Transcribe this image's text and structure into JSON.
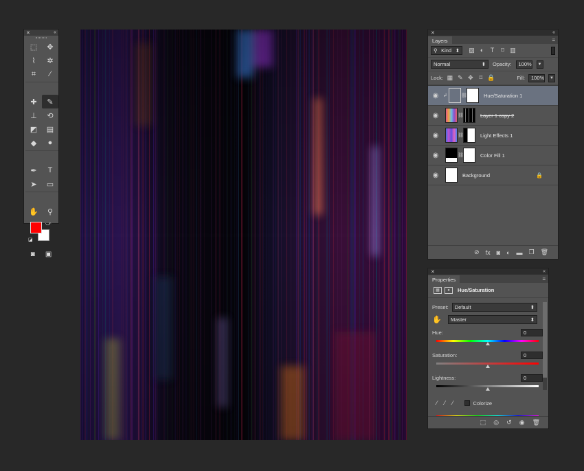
{
  "tools_panel": {
    "close_glyph": "✕",
    "collapse_glyph": "«",
    "tools": [
      {
        "name": "marquee-tool-icon",
        "glyph": "⬚"
      },
      {
        "name": "move-tool-icon",
        "glyph": "✥"
      },
      {
        "name": "lasso-tool-icon",
        "glyph": "⌇"
      },
      {
        "name": "magic-wand-tool-icon",
        "glyph": "✲"
      },
      {
        "name": "crop-tool-icon",
        "glyph": "⌗"
      },
      {
        "name": "eyedropper-tool-icon",
        "glyph": "⁄"
      },
      {
        "name": "healing-brush-tool-icon",
        "glyph": "✚"
      },
      {
        "name": "brush-tool-icon",
        "glyph": "✎",
        "active": true
      },
      {
        "name": "clone-stamp-tool-icon",
        "glyph": "⊥"
      },
      {
        "name": "history-brush-tool-icon",
        "glyph": "⟲"
      },
      {
        "name": "eraser-tool-icon",
        "glyph": "◩"
      },
      {
        "name": "gradient-tool-icon",
        "glyph": "▤"
      },
      {
        "name": "blur-tool-icon",
        "glyph": "◆"
      },
      {
        "name": "dodge-tool-icon",
        "glyph": "●"
      },
      {
        "name": "pen-tool-icon",
        "glyph": "✒"
      },
      {
        "name": "type-tool-icon",
        "glyph": "T"
      },
      {
        "name": "path-selection-tool-icon",
        "glyph": "➤"
      },
      {
        "name": "rectangle-tool-icon",
        "glyph": "▭"
      },
      {
        "name": "hand-tool-icon",
        "glyph": "✋"
      },
      {
        "name": "zoom-tool-icon",
        "glyph": "⚲"
      }
    ],
    "foreground_color": "#ff0000",
    "background_color": "#ffffff",
    "quick_mask_glyph": "◙",
    "screen_mode_glyph": "▣"
  },
  "layers_panel": {
    "close_glyph": "✕",
    "collapse_glyph": "«",
    "tab_label": "Layers",
    "menu_glyph": "≡",
    "filter_kind": "Kind",
    "filter_icons": [
      "image-filter-icon",
      "adjustment-filter-icon",
      "type-filter-icon",
      "shape-filter-icon",
      "smart-object-filter-icon"
    ],
    "filter_glyphs": [
      "▨",
      "◐",
      "T",
      "⌑",
      "▥"
    ],
    "blend_mode": "Normal",
    "opacity_label": "Opacity:",
    "opacity_value": "100%",
    "lock_label": "Lock:",
    "lock_glyphs": [
      "▦",
      "✎",
      "✥",
      "⌑",
      "🔒"
    ],
    "fill_label": "Fill:",
    "fill_value": "100%",
    "layers": [
      {
        "name": "Hue/Saturation 1",
        "selected": true,
        "thumb": "adjustment",
        "has_mask": true,
        "strike": false
      },
      {
        "name": "Layer 1 copy 2",
        "selected": false,
        "thumb": "rainbow",
        "has_mask": true,
        "mask": "dark",
        "strike": true
      },
      {
        "name": "Light Effects 1",
        "selected": false,
        "thumb": "rainbow2",
        "has_mask": true,
        "mask": "split",
        "strike": false
      },
      {
        "name": "Color Fill 1",
        "selected": false,
        "thumb": "black",
        "has_mask": true,
        "strike": false
      },
      {
        "name": "Background",
        "selected": false,
        "thumb": "white",
        "has_mask": false,
        "locked": true,
        "strike": false
      }
    ],
    "footer_glyphs": [
      "⊘",
      "fx",
      "◙",
      "◐",
      "▬",
      "❐",
      "🗑"
    ]
  },
  "properties_panel": {
    "close_glyph": "✕",
    "collapse_glyph": "«",
    "tab_label": "Properties",
    "menu_glyph": "≡",
    "title": "Hue/Saturation",
    "preset_label": "Preset:",
    "preset_value": "Default",
    "channel_value": "Master",
    "hue_label": "Hue:",
    "hue_value": "0",
    "saturation_label": "Saturation:",
    "saturation_value": "0",
    "lightness_label": "Lightness:",
    "lightness_value": "0",
    "colorize_label": "Colorize",
    "footer_glyphs": [
      "⬚",
      "◎",
      "↺",
      "◉",
      "🗑"
    ]
  }
}
